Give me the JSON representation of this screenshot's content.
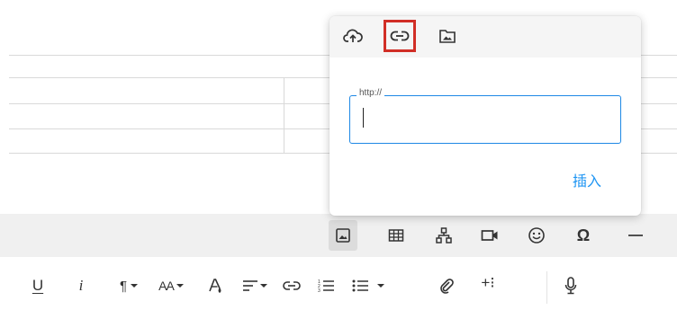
{
  "popup": {
    "tabs": [
      {
        "icon": "upload-cloud-icon"
      },
      {
        "icon": "link-icon",
        "selected": true
      },
      {
        "icon": "folder-image-icon"
      }
    ],
    "url_legend": "http://",
    "url_value": "",
    "insert_label": "插入"
  },
  "insert_toolbar": {
    "items": [
      "image-icon",
      "table-icon",
      "sitemap-icon",
      "video-icon",
      "emoji-icon",
      "special-char-icon",
      "horizontal-line-icon"
    ],
    "omega_glyph": "Ω"
  },
  "format_toolbar": {
    "items": [
      "underline",
      "italic",
      "paragraph-format",
      "font-size",
      "text-color",
      "align",
      "insert-link",
      "ordered-list",
      "unordered-list",
      "attachment",
      "more",
      "microphone"
    ],
    "underline_glyph": "U",
    "italic_glyph": "i",
    "paragraph_glyph": "¶",
    "font_size_glyph": "AA",
    "more_glyph": "+⁝"
  },
  "colors": {
    "accent": "#2196f3",
    "highlight_border": "#d12e26",
    "toolbar_bg": "#f0f0f0"
  }
}
